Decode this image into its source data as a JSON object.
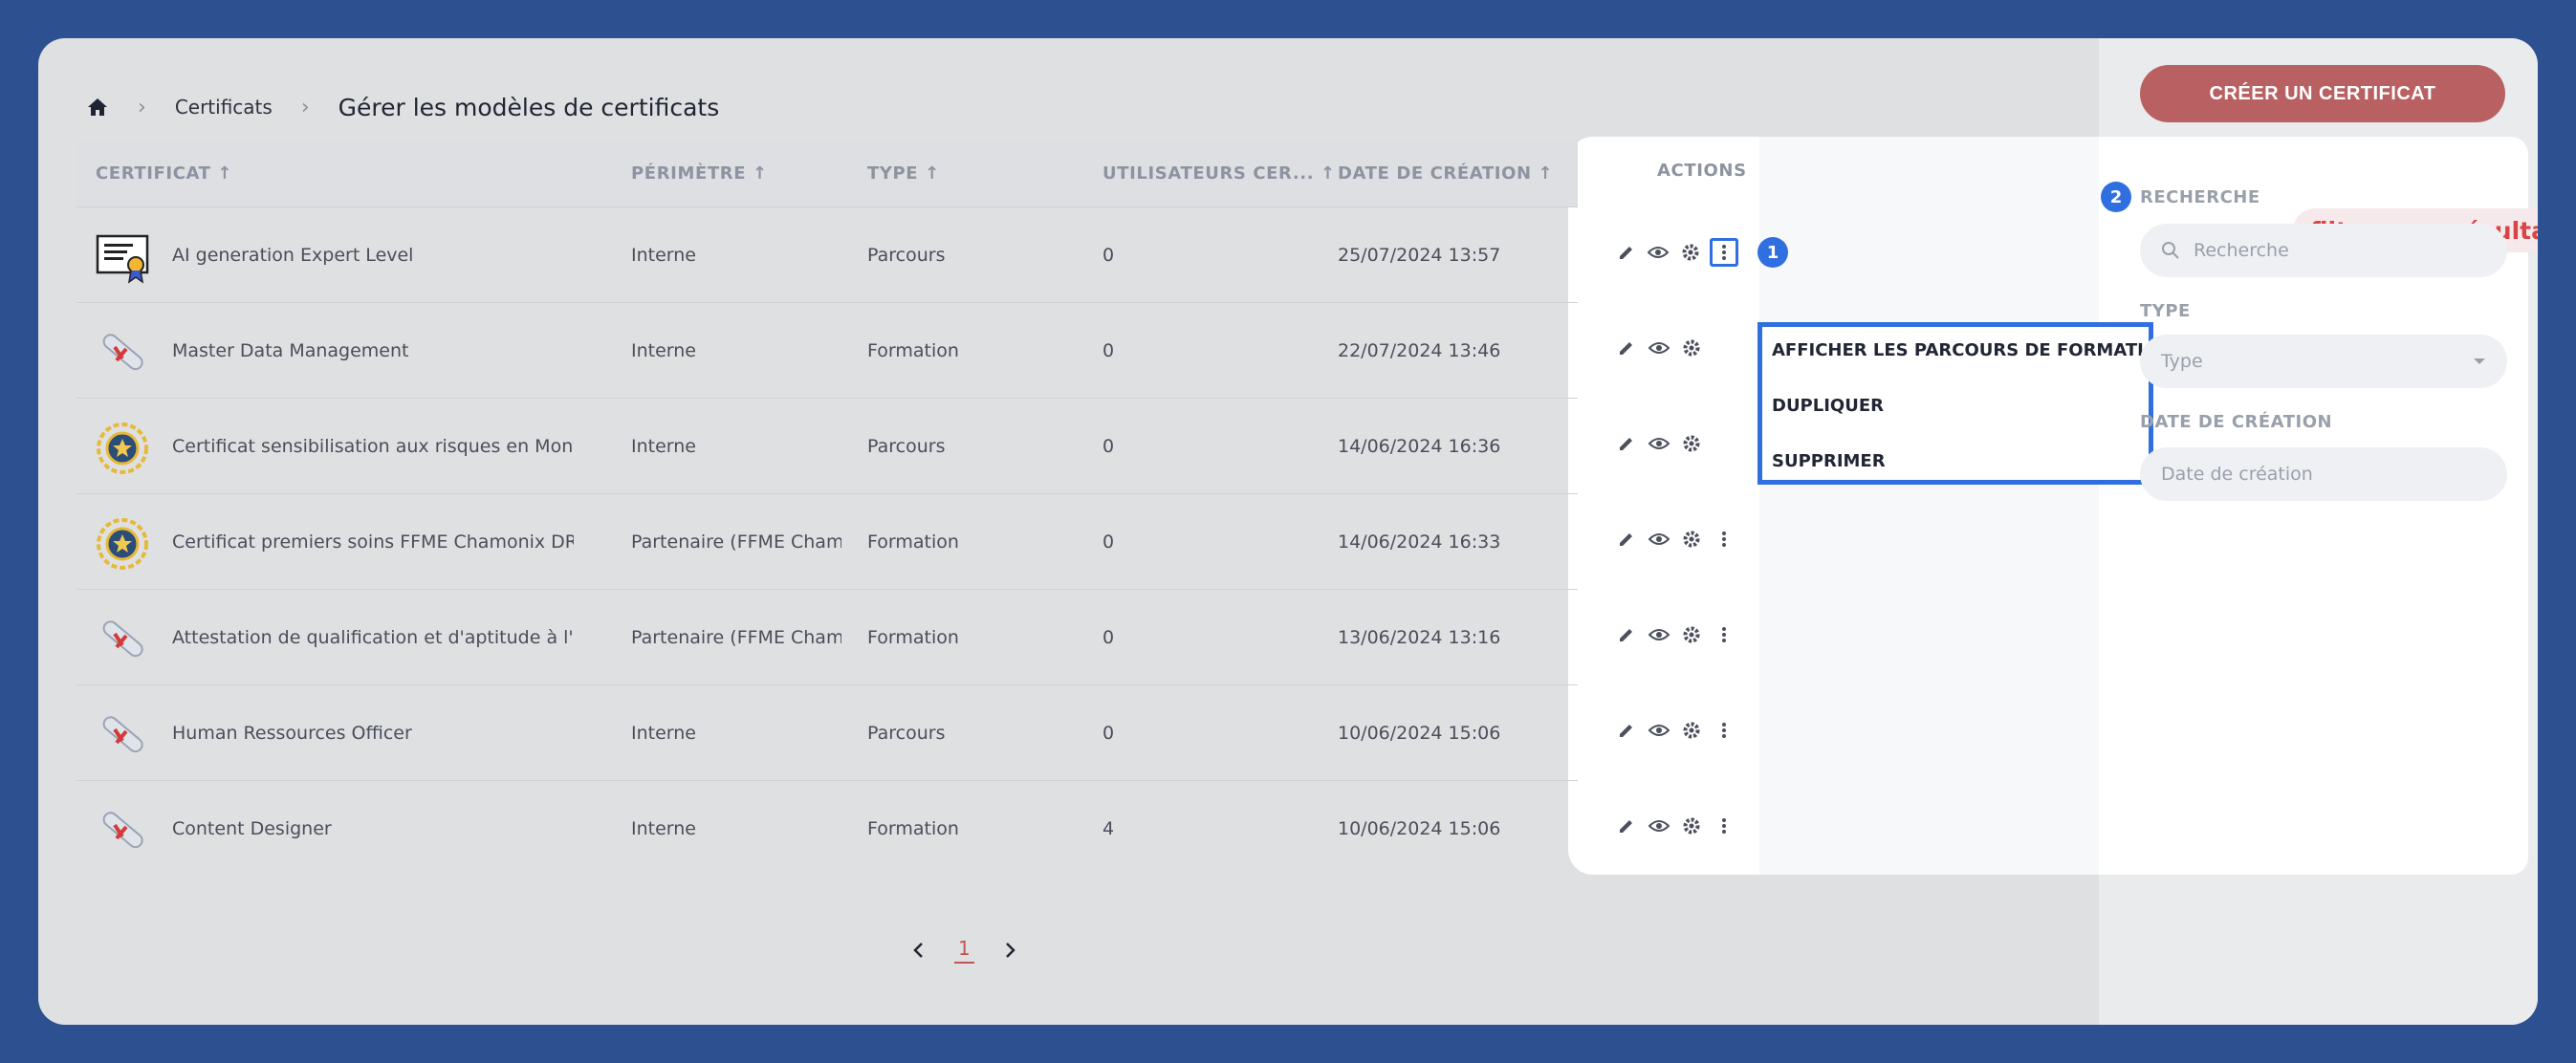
{
  "breadcrumb": {
    "level1": "Certificats",
    "current": "Gérer les modèles de certificats"
  },
  "create_button": "CRÉER UN CERTIFICAT",
  "columns": {
    "certificat": "CERTIFICAT",
    "perimetre": "PÉRIMÈTRE",
    "type": "TYPE",
    "users": "UTILISATEURS CER...",
    "date": "DATE DE CRÉATION",
    "actions": "ACTIONS"
  },
  "rows": [
    {
      "icon": "certificate-document-icon",
      "name": "AI generation Expert Level",
      "perimetre": "Interne",
      "type": "Parcours",
      "users": "0",
      "date": "25/07/2024 13:57"
    },
    {
      "icon": "diploma-scroll-icon",
      "name": "Master Data Management",
      "perimetre": "Interne",
      "type": "Formation",
      "users": "0",
      "date": "22/07/2024 13:46"
    },
    {
      "icon": "gold-medal-icon",
      "name": "Certificat sensibilisation aux risques en Montagn...",
      "perimetre": "Interne",
      "type": "Parcours",
      "users": "0",
      "date": "14/06/2024 16:36"
    },
    {
      "icon": "gold-medal-icon",
      "name": "Certificat premiers soins FFME Chamonix DR",
      "perimetre": "Partenaire (FFME Chamo...",
      "type": "Formation",
      "users": "0",
      "date": "14/06/2024 16:33"
    },
    {
      "icon": "diploma-scroll-icon",
      "name": "Attestation de qualification et d'aptitude à l'ensei...",
      "perimetre": "Partenaire (FFME Chamo...",
      "type": "Formation",
      "users": "0",
      "date": "13/06/2024 13:16"
    },
    {
      "icon": "diploma-scroll-icon",
      "name": "Human Ressources Officer",
      "perimetre": "Interne",
      "type": "Parcours",
      "users": "0",
      "date": "10/06/2024 15:06"
    },
    {
      "icon": "diploma-scroll-icon",
      "name": "Content Designer",
      "perimetre": "Interne",
      "type": "Formation",
      "users": "4",
      "date": "10/06/2024 15:06"
    }
  ],
  "menu": {
    "item1": "AFFICHER LES PARCOURS DE FORMATION LIÉS",
    "item2": "DUPLIQUER",
    "item3": "SUPPRIMER"
  },
  "badges": {
    "one": "1",
    "two": "2"
  },
  "tooltip": "filtrez vos résultats",
  "filters": {
    "search_label": "RECHERCHE",
    "search_placeholder": "Recherche",
    "type_label": "TYPE",
    "type_placeholder": "Type",
    "date_label": "DATE DE CRÉATION",
    "date_placeholder": "Date de création"
  },
  "pagination": {
    "current_page": "1"
  },
  "colors": {
    "accent": "#2f6fe0",
    "brand_button": "#b96062",
    "tooltip_text": "#d94545",
    "background": "#2c5090"
  }
}
